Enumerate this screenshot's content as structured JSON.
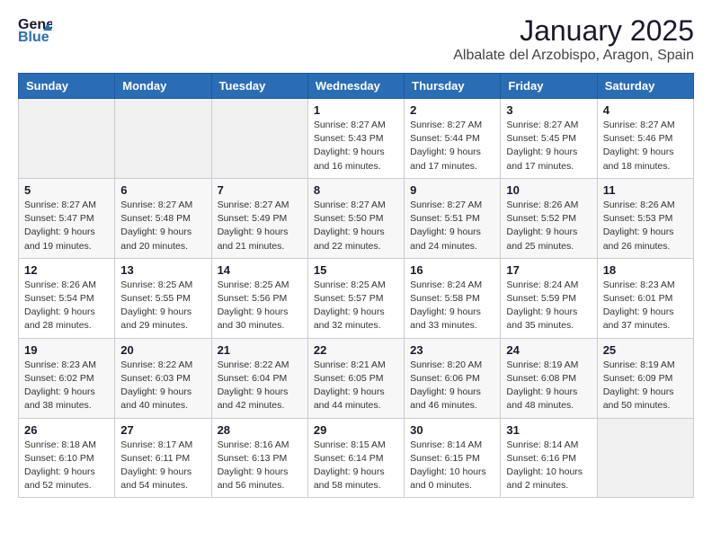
{
  "header": {
    "logo_general": "General",
    "logo_blue": "Blue",
    "title": "January 2025",
    "subtitle": "Albalate del Arzobispo, Aragon, Spain"
  },
  "days_of_week": [
    "Sunday",
    "Monday",
    "Tuesday",
    "Wednesday",
    "Thursday",
    "Friday",
    "Saturday"
  ],
  "weeks": [
    [
      {
        "day": "",
        "info": ""
      },
      {
        "day": "",
        "info": ""
      },
      {
        "day": "",
        "info": ""
      },
      {
        "day": "1",
        "info": "Sunrise: 8:27 AM\nSunset: 5:43 PM\nDaylight: 9 hours and 16 minutes."
      },
      {
        "day": "2",
        "info": "Sunrise: 8:27 AM\nSunset: 5:44 PM\nDaylight: 9 hours and 17 minutes."
      },
      {
        "day": "3",
        "info": "Sunrise: 8:27 AM\nSunset: 5:45 PM\nDaylight: 9 hours and 17 minutes."
      },
      {
        "day": "4",
        "info": "Sunrise: 8:27 AM\nSunset: 5:46 PM\nDaylight: 9 hours and 18 minutes."
      }
    ],
    [
      {
        "day": "5",
        "info": "Sunrise: 8:27 AM\nSunset: 5:47 PM\nDaylight: 9 hours and 19 minutes."
      },
      {
        "day": "6",
        "info": "Sunrise: 8:27 AM\nSunset: 5:48 PM\nDaylight: 9 hours and 20 minutes."
      },
      {
        "day": "7",
        "info": "Sunrise: 8:27 AM\nSunset: 5:49 PM\nDaylight: 9 hours and 21 minutes."
      },
      {
        "day": "8",
        "info": "Sunrise: 8:27 AM\nSunset: 5:50 PM\nDaylight: 9 hours and 22 minutes."
      },
      {
        "day": "9",
        "info": "Sunrise: 8:27 AM\nSunset: 5:51 PM\nDaylight: 9 hours and 24 minutes."
      },
      {
        "day": "10",
        "info": "Sunrise: 8:26 AM\nSunset: 5:52 PM\nDaylight: 9 hours and 25 minutes."
      },
      {
        "day": "11",
        "info": "Sunrise: 8:26 AM\nSunset: 5:53 PM\nDaylight: 9 hours and 26 minutes."
      }
    ],
    [
      {
        "day": "12",
        "info": "Sunrise: 8:26 AM\nSunset: 5:54 PM\nDaylight: 9 hours and 28 minutes."
      },
      {
        "day": "13",
        "info": "Sunrise: 8:25 AM\nSunset: 5:55 PM\nDaylight: 9 hours and 29 minutes."
      },
      {
        "day": "14",
        "info": "Sunrise: 8:25 AM\nSunset: 5:56 PM\nDaylight: 9 hours and 30 minutes."
      },
      {
        "day": "15",
        "info": "Sunrise: 8:25 AM\nSunset: 5:57 PM\nDaylight: 9 hours and 32 minutes."
      },
      {
        "day": "16",
        "info": "Sunrise: 8:24 AM\nSunset: 5:58 PM\nDaylight: 9 hours and 33 minutes."
      },
      {
        "day": "17",
        "info": "Sunrise: 8:24 AM\nSunset: 5:59 PM\nDaylight: 9 hours and 35 minutes."
      },
      {
        "day": "18",
        "info": "Sunrise: 8:23 AM\nSunset: 6:01 PM\nDaylight: 9 hours and 37 minutes."
      }
    ],
    [
      {
        "day": "19",
        "info": "Sunrise: 8:23 AM\nSunset: 6:02 PM\nDaylight: 9 hours and 38 minutes."
      },
      {
        "day": "20",
        "info": "Sunrise: 8:22 AM\nSunset: 6:03 PM\nDaylight: 9 hours and 40 minutes."
      },
      {
        "day": "21",
        "info": "Sunrise: 8:22 AM\nSunset: 6:04 PM\nDaylight: 9 hours and 42 minutes."
      },
      {
        "day": "22",
        "info": "Sunrise: 8:21 AM\nSunset: 6:05 PM\nDaylight: 9 hours and 44 minutes."
      },
      {
        "day": "23",
        "info": "Sunrise: 8:20 AM\nSunset: 6:06 PM\nDaylight: 9 hours and 46 minutes."
      },
      {
        "day": "24",
        "info": "Sunrise: 8:19 AM\nSunset: 6:08 PM\nDaylight: 9 hours and 48 minutes."
      },
      {
        "day": "25",
        "info": "Sunrise: 8:19 AM\nSunset: 6:09 PM\nDaylight: 9 hours and 50 minutes."
      }
    ],
    [
      {
        "day": "26",
        "info": "Sunrise: 8:18 AM\nSunset: 6:10 PM\nDaylight: 9 hours and 52 minutes."
      },
      {
        "day": "27",
        "info": "Sunrise: 8:17 AM\nSunset: 6:11 PM\nDaylight: 9 hours and 54 minutes."
      },
      {
        "day": "28",
        "info": "Sunrise: 8:16 AM\nSunset: 6:13 PM\nDaylight: 9 hours and 56 minutes."
      },
      {
        "day": "29",
        "info": "Sunrise: 8:15 AM\nSunset: 6:14 PM\nDaylight: 9 hours and 58 minutes."
      },
      {
        "day": "30",
        "info": "Sunrise: 8:14 AM\nSunset: 6:15 PM\nDaylight: 10 hours and 0 minutes."
      },
      {
        "day": "31",
        "info": "Sunrise: 8:14 AM\nSunset: 6:16 PM\nDaylight: 10 hours and 2 minutes."
      },
      {
        "day": "",
        "info": ""
      }
    ]
  ]
}
